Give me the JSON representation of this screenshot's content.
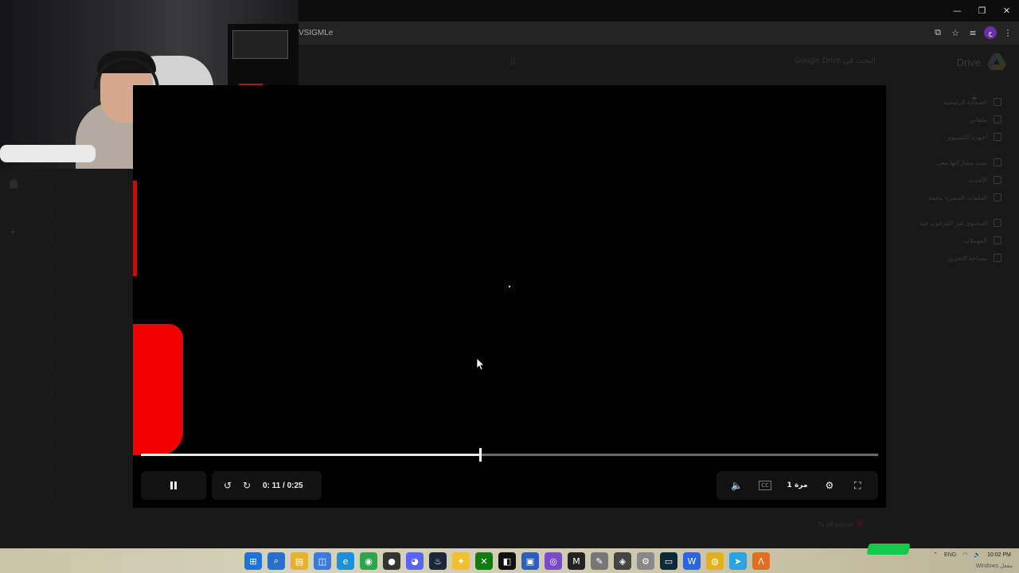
{
  "browser": {
    "url_fragment": "VSIGMLe",
    "window_controls": [
      "minimize",
      "restore",
      "close"
    ],
    "profile_initial": "ج"
  },
  "drive": {
    "logo_text": "Drive",
    "search_placeholder": "Google Drive البحث في",
    "sidebar_items": [
      "الصفحة الرئيسية",
      "ملفاتي",
      "أجهزة الكمبيوتر",
      "تمت مشاركتها معي",
      "الأحدث",
      "الملفات المميزة بنجمة",
      "المحتوى غير المرغوب فيه",
      "المهملات",
      "مساحة التخزين"
    ],
    "footer_right": "Ts off subset"
  },
  "player": {
    "current_time": "0: 11",
    "duration": "0:25",
    "time_display": "0: 11 / 0:25",
    "progress_fraction": 0.46,
    "speed_label": "1 مرة",
    "icons": {
      "play_pause": "pause-icon",
      "rewind": "replay-10-icon",
      "forward": "forward-10-icon",
      "volume": "volume-icon",
      "captions": "captions-icon",
      "settings": "gear-icon",
      "fullscreen": "fullscreen-icon"
    },
    "accent_color": "#ff0000"
  },
  "taskbar": {
    "tray_lang": "ENG",
    "clock_time": "10:02 PM",
    "watermark": "Windows مفعل"
  }
}
